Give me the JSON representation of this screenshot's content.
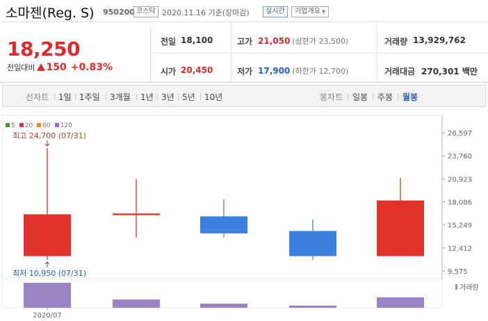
{
  "header": {
    "stock_name": "소마젠(Reg. S)",
    "stock_code": "950200",
    "market": "코스닥",
    "date": "2020.11.16 기준(장마감)",
    "realtime_label": "실시간",
    "company_info_label": "기업개요"
  },
  "quote": {
    "price": "18,250",
    "change_label": "전일대비",
    "change_value": "150",
    "change_pct": "+0.83%",
    "prev_close_label": "전일",
    "prev_close": "18,100",
    "high_label": "고가",
    "high": "21,050",
    "upper_limit": "(상한가 23,500)",
    "volume_label": "거래량",
    "volume": "13,929,762",
    "open_label": "시가",
    "open": "20,450",
    "low_label": "저가",
    "low": "17,900",
    "lower_limit": "(하한가 12,700)",
    "amount_label": "거래대금",
    "amount": "270,301",
    "amount_unit": "백만"
  },
  "period_bar": {
    "line_chart_label": "선차트",
    "line_periods": [
      "1일",
      "1주일",
      "3개월",
      "1년",
      "3년",
      "5년",
      "10년"
    ],
    "candle_label": "봉차트",
    "candle_periods": [
      "일봉",
      "주봉",
      "월봉"
    ],
    "active_candle": "월봉"
  },
  "colors": {
    "up": "#e0322b",
    "down": "#3b82e0",
    "volume": "#9b85c8"
  },
  "chart_data": {
    "type": "candlestick",
    "moving_averages": [
      {
        "label": "5",
        "color": "#3a9a3a"
      },
      {
        "label": "20",
        "color": "#e03a3a"
      },
      {
        "label": "60",
        "color": "#f08a1a"
      },
      {
        "label": "120",
        "color": "#9b6ac8"
      }
    ],
    "x_tick_label": "2020/07",
    "y_ticks": [
      26597,
      23760,
      20923,
      18086,
      15249,
      12412,
      9575
    ],
    "y_tick_labels": [
      "26,597",
      "23,760",
      "20,923",
      "18,086",
      "15,249",
      "12,412",
      "9,575"
    ],
    "ylim": [
      9575,
      26597
    ],
    "candles": [
      {
        "open": 11400,
        "close": 16550,
        "high": 24700,
        "low": 10950,
        "volume": 1.0
      },
      {
        "open": 16450,
        "close": 16650,
        "high": 20900,
        "low": 13700,
        "volume": 0.33
      },
      {
        "open": 16300,
        "close": 14200,
        "high": 18400,
        "low": 13700,
        "volume": 0.17
      },
      {
        "open": 14500,
        "close": 11400,
        "high": 15900,
        "low": 10900,
        "volume": 0.09
      },
      {
        "open": 11400,
        "close": 18250,
        "high": 21050,
        "low": 11400,
        "volume": 0.42
      }
    ],
    "max_label": "최고 24,700 (07/31)",
    "min_label": "최저 10,950 (07/31)",
    "volume_legend": "거래량"
  }
}
